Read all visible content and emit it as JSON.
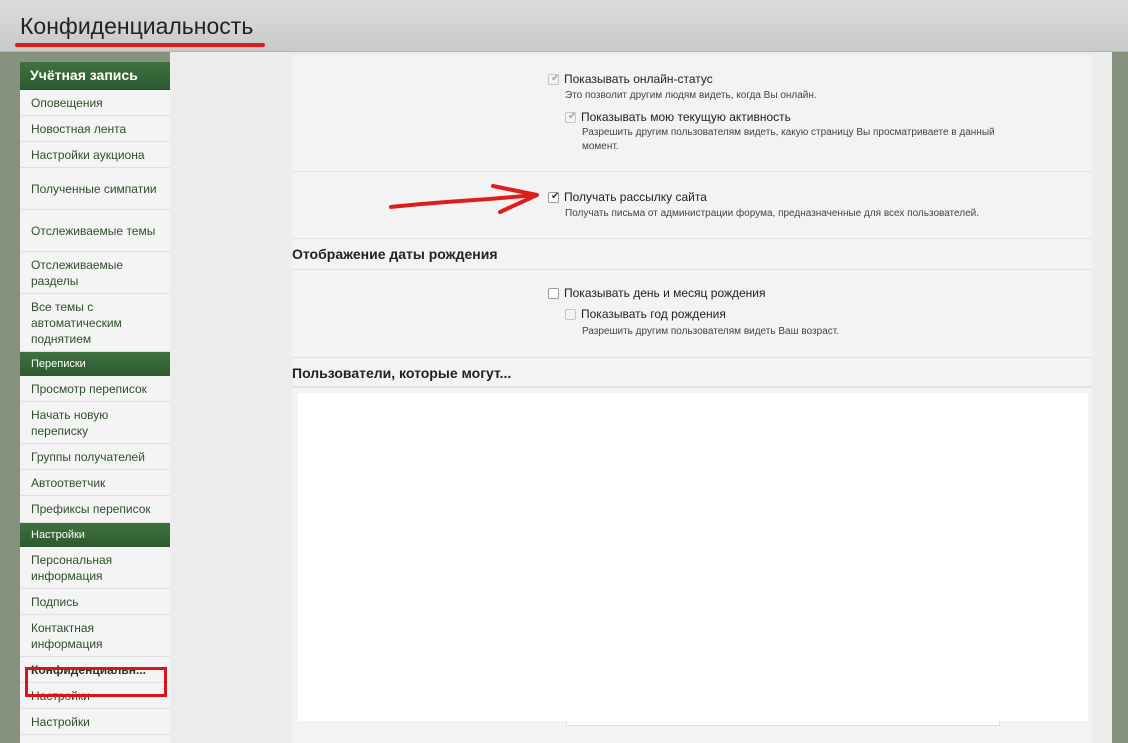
{
  "header": {
    "title": "Конфиденциальность"
  },
  "sidebar": {
    "account_heading": "Учётная запись",
    "account_items": [
      {
        "label": "Оповещения"
      },
      {
        "label": "Новостная лента"
      },
      {
        "label": "Настройки аукциона"
      },
      {
        "label": "Полученные симпатии"
      },
      {
        "label": "Отслеживаемые темы"
      },
      {
        "label": "Отслеживаемые разделы"
      },
      {
        "label": "Все темы с автоматическим поднятием"
      }
    ],
    "messages_heading": "Переписки",
    "messages_items": [
      {
        "label": "Просмотр переписок"
      },
      {
        "label": "Начать новую переписку"
      },
      {
        "label": "Группы получателей"
      },
      {
        "label": "Автоответчик"
      },
      {
        "label": "Префиксы переписок"
      }
    ],
    "settings_heading": "Настройки",
    "settings_items": [
      {
        "label": "Персональная информация"
      },
      {
        "label": "Подпись"
      },
      {
        "label": "Контактная информация"
      },
      {
        "label": "Конфиденциальн..."
      },
      {
        "label": "Настройки"
      },
      {
        "label": "Настройки"
      }
    ]
  },
  "privacy": {
    "online_status": {
      "label": "Показывать онлайн-статус",
      "description": "Это позволит другим людям видеть, когда Вы онлайн.",
      "checked": true
    },
    "current_activity": {
      "label": "Показывать мою текущую активность",
      "description_line1": "Разрешить другим пользователям видеть, какую страницу Вы просматриваете в данный",
      "description_line2": "момент.",
      "checked": true
    },
    "newsletter": {
      "label": "Получать рассылку сайта",
      "description": "Получать письма от администрации форума, предназначенные для всех пользователей.",
      "checked": true
    }
  },
  "birthday": {
    "title": "Отображение даты рождения",
    "show_dob": {
      "label": "Показывать день и месяц рождения",
      "checked": false
    },
    "show_year": {
      "label": "Показывать год рождения",
      "description": "Разрешить другим пользователям видеть Ваш возраст.",
      "checked": false
    }
  },
  "users_section": {
    "title": "Пользователи, которые могут..."
  },
  "colors": {
    "accent_green": "#2d5a2e",
    "annotation_red": "#e01d1d"
  }
}
